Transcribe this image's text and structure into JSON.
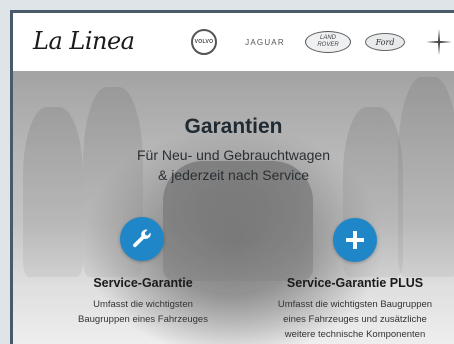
{
  "header": {
    "logo_text": "La Linea",
    "brands": {
      "volvo": "VOLVO",
      "jaguar": "JAGUAR",
      "landrover_line1": "LAND",
      "landrover_line2": "ROVER",
      "ford": "Ford"
    }
  },
  "hero": {
    "title": "Garantien",
    "subtitle_line1": "Für Neu- und Gebrauchtwagen",
    "subtitle_line2": "& jederzeit nach Service"
  },
  "features": [
    {
      "title": "Service-Garantie",
      "desc_line1": "Umfasst die wichtigsten",
      "desc_line2": "Baugruppen eines Fahrzeuges",
      "icon": "wrench-icon"
    },
    {
      "title": "Service-Garantie PLUS",
      "desc_line1": "Umfasst die wichtigsten Baugruppen",
      "desc_line2": "eines Fahrzeuges und zusätzliche",
      "desc_line3": "weitere technische Komponenten",
      "icon": "plus-icon"
    }
  ],
  "colors": {
    "accent": "#1f86c8",
    "frame": "#4a5a6a"
  }
}
